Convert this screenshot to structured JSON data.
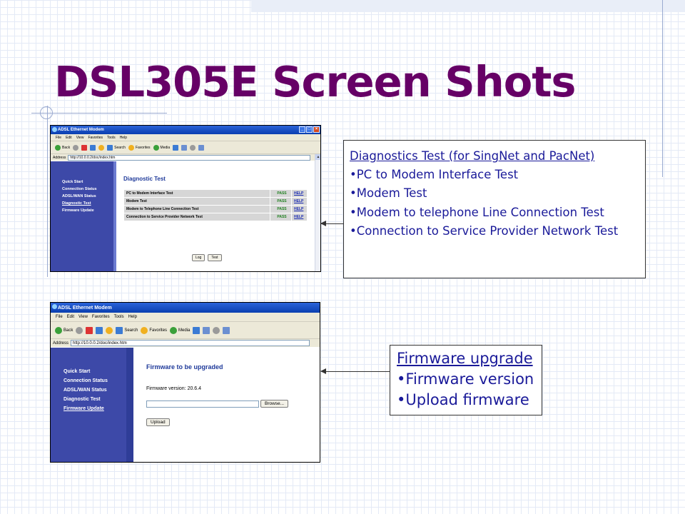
{
  "slide": {
    "title": "DSL305E Screen Shots"
  },
  "window1": {
    "title": "ADSL Ethernet Modem",
    "menu": [
      "File",
      "Edit",
      "View",
      "Favorites",
      "Tools",
      "Help"
    ],
    "toolbar": {
      "back": "Back",
      "search": "Search",
      "favorites": "Favorites",
      "media": "Media",
      "tooltip": "Print"
    },
    "address": {
      "label": "Address",
      "url": "http://10.0.0.2/doc/index.htm"
    },
    "nav": [
      "Quick Start",
      "Connection Status",
      "ADSL/WAN Status",
      "Diagnostic Test",
      "Firmware Update"
    ],
    "page_title": "Diagnostic Test",
    "tests": [
      {
        "name": "PC to Modem Interface Test",
        "result": "PASS",
        "help": "HELP"
      },
      {
        "name": "Modem Test",
        "result": "PASS",
        "help": "HELP"
      },
      {
        "name": "Modem to Telephone Line Connection Test",
        "result": "PASS",
        "help": "HELP"
      },
      {
        "name": "Connection to Service Provider Network Test",
        "result": "PASS",
        "help": "HELP"
      }
    ],
    "buttons": {
      "log": "Log",
      "test": "Test"
    }
  },
  "window2": {
    "title": "ADSL Ethernet Modem",
    "menu": [
      "File",
      "Edit",
      "View",
      "Favorites",
      "Tools",
      "Help"
    ],
    "toolbar": {
      "back": "Back",
      "search": "Search",
      "favorites": "Favorites",
      "media": "Media"
    },
    "address": {
      "label": "Address",
      "url": "http://10.0.0.2/doc/index.htm"
    },
    "nav": [
      "Quick Start",
      "Connection Status",
      "ADSL/WAN Status",
      "Diagnostic Test",
      "Firmware Update"
    ],
    "page_title": "Firmware to be upgraded",
    "firmware_version": "Firmware version: 20.6.4",
    "buttons": {
      "browse": "Browse...",
      "upload": "Upload"
    }
  },
  "callout1": {
    "heading": "Diagnostics Test (for SingNet and PacNet)",
    "items": [
      "PC to Modem Interface Test",
      "Modem Test",
      "Modem to telephone Line Connection Test",
      "Connection to Service Provider Network Test"
    ]
  },
  "callout2": {
    "heading": "Firmware upgrade",
    "items": [
      "Firmware version",
      "Upload firmware"
    ]
  },
  "colors": {
    "title": "#660066",
    "callout_text": "#1a1a99",
    "nav_bg": "#3d49a8",
    "ie_title": "#0a3fb0"
  }
}
